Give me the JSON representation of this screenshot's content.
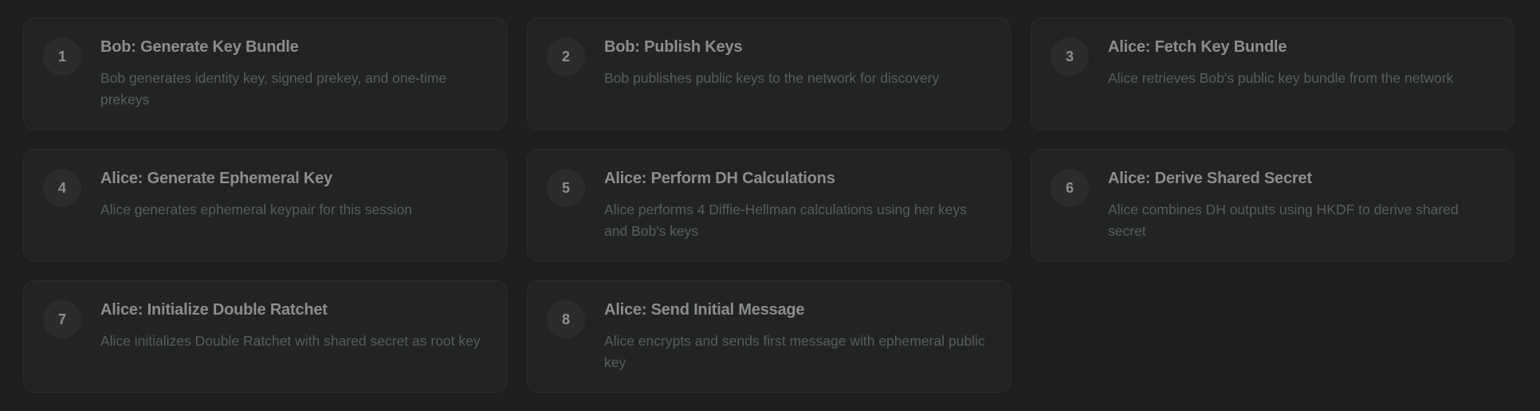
{
  "steps": [
    {
      "number": "1",
      "title": "Bob: Generate Key Bundle",
      "description": "Bob generates identity key, signed prekey, and one-time prekeys"
    },
    {
      "number": "2",
      "title": "Bob: Publish Keys",
      "description": "Bob publishes public keys to the network for discovery"
    },
    {
      "number": "3",
      "title": "Alice: Fetch Key Bundle",
      "description": "Alice retrieves Bob's public key bundle from the network"
    },
    {
      "number": "4",
      "title": "Alice: Generate Ephemeral Key",
      "description": "Alice generates ephemeral keypair for this session"
    },
    {
      "number": "5",
      "title": "Alice: Perform DH Calculations",
      "description": "Alice performs 4 Diffie-Hellman calculations using her keys and Bob's keys"
    },
    {
      "number": "6",
      "title": "Alice: Derive Shared Secret",
      "description": "Alice combines DH outputs using HKDF to derive shared secret"
    },
    {
      "number": "7",
      "title": "Alice: Initialize Double Ratchet",
      "description": "Alice initializes Double Ratchet with shared secret as root key"
    },
    {
      "number": "8",
      "title": "Alice: Send Initial Message",
      "description": "Alice encrypts and sends first message with ephemeral public key"
    }
  ]
}
